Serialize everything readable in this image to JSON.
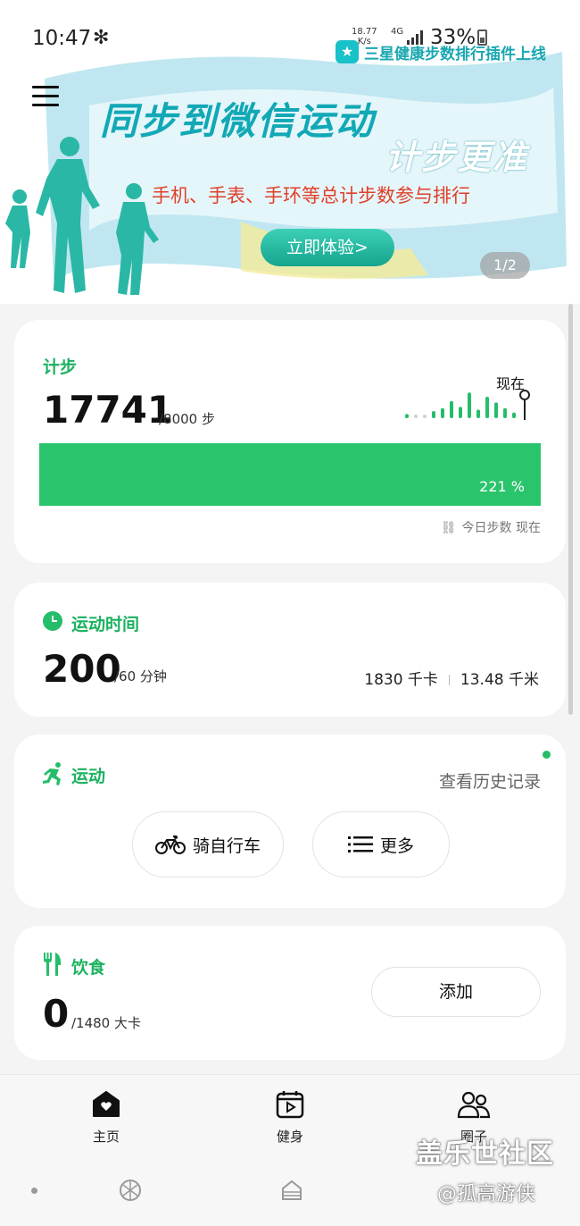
{
  "status_bar": {
    "time": "10:47",
    "net_speed_value": "18.77",
    "net_speed_unit": "K/s",
    "network": "4G",
    "battery": "33%"
  },
  "banner": {
    "promo_text": "三星健康步数排行插件上线",
    "headline_line1": "同步到微信运动",
    "headline_line2": "计步更准",
    "subtitle": "手机、手表、手环等总计步数参与排行",
    "cta": "立即体验>",
    "pager": "1/2"
  },
  "steps": {
    "title": "计步",
    "value": "17741",
    "goal": "/8000 步",
    "now_label": "现在",
    "progress_percent": "221 %",
    "progress_fraction": 1.0,
    "mini_bars": [
      0.15,
      0.1,
      0.1,
      0.25,
      0.35,
      0.6,
      0.4,
      0.9,
      0.3,
      0.75,
      0.55,
      0.35,
      0.2
    ],
    "link_text": "今日步数 现在"
  },
  "exercise_time": {
    "title": "运动时间",
    "value": "200",
    "goal": "/60 分钟",
    "calories": "1830 千卡",
    "distance": "13.48 千米"
  },
  "sports": {
    "title": "运动",
    "history": "查看历史记录",
    "bike": "骑自行车",
    "more": "更多"
  },
  "food": {
    "title": "饮食",
    "value": "0",
    "goal": "/1480 大卡",
    "add": "添加"
  },
  "nav": {
    "home": "主页",
    "fitness": "健身",
    "group": "圈子"
  },
  "watermark": {
    "forum": "盖乐世社区",
    "user": "@孤高游侠"
  },
  "colors": {
    "accent": "#25bd6a",
    "progress": "#2ac46c",
    "banner_teal": "#12a8b6",
    "banner_red": "#e0402a"
  }
}
